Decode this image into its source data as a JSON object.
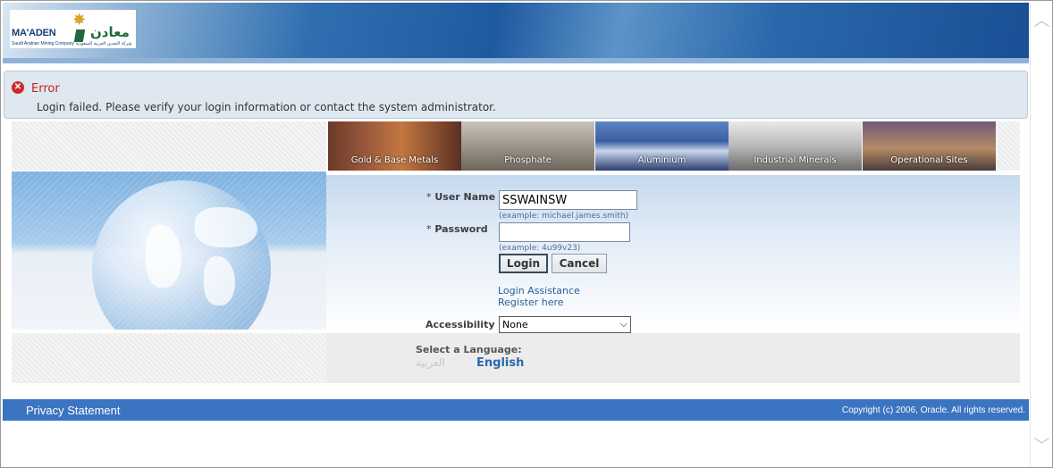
{
  "logo": {
    "name_en": "MA'ADEN",
    "name_ar": "معادن",
    "subtitle": "Saudi Arabian Mining Company  شركة التعدين العربية السعودية"
  },
  "error": {
    "title": "Error",
    "message": "Login failed. Please verify your login information or contact the system administrator."
  },
  "categories": [
    {
      "label": "Gold & Base Metals"
    },
    {
      "label": "Phosphate"
    },
    {
      "label": "Aluminium"
    },
    {
      "label": "Industrial Minerals"
    },
    {
      "label": "Operational Sites"
    }
  ],
  "form": {
    "required_marker": "*",
    "username_label": "User Name",
    "username_value": "SSWAINSW",
    "username_hint": "(example: michael.james.smith)",
    "password_label": "Password",
    "password_value": "",
    "password_hint": "(example: 4u99v23)",
    "login_button": "Login",
    "cancel_button": "Cancel",
    "login_assistance": "Login Assistance",
    "register": "Register here",
    "accessibility_label": "Accessibility",
    "accessibility_value": "None"
  },
  "language": {
    "title": "Select a Language:",
    "arabic": "العربية",
    "english": "English"
  },
  "footer": {
    "privacy": "Privacy Statement",
    "copyright": "Copyright (c) 2006, Oracle. All rights reserved."
  },
  "colors": {
    "error_red": "#c0241e",
    "footer_blue": "#3b74c1",
    "link_blue": "#2b5f95"
  }
}
